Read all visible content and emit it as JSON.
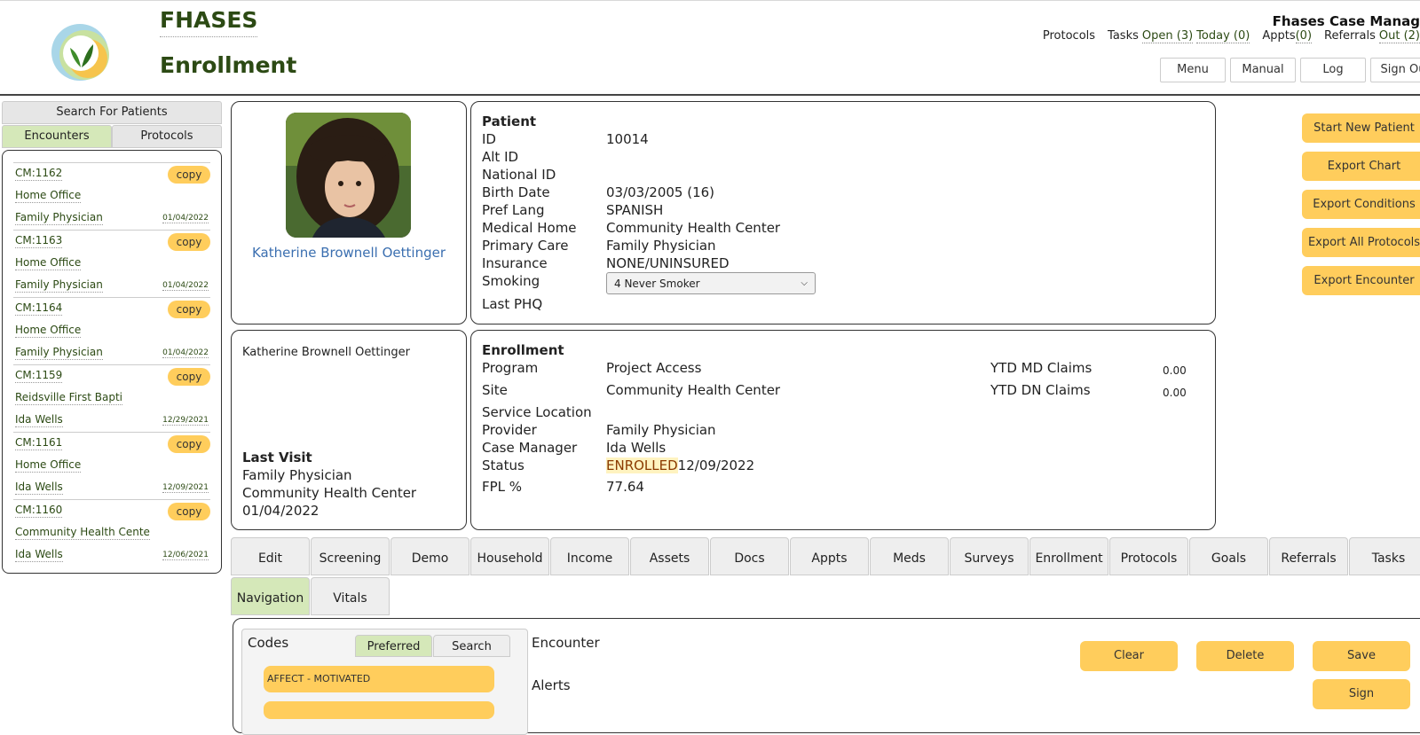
{
  "brand": {
    "title": "FHASES",
    "page_title": "Enrollment",
    "app_name": "Fhases Case Manag"
  },
  "topnav": {
    "protocols": "Protocols",
    "tasks_label": "Tasks",
    "tasks_open": "Open (3)",
    "tasks_today": "Today (0)",
    "appts_label": "Appts",
    "appts_count": "(0)",
    "referrals_label": "Referrals",
    "referrals_out": "Out (2)"
  },
  "header_buttons": {
    "menu": "Menu",
    "manual": "Manual",
    "log": "Log",
    "sign_out": "Sign Ou"
  },
  "sidebar": {
    "search": "Search For Patients",
    "tabs": [
      "Encounters",
      "Protocols"
    ],
    "copy_label": "copy",
    "encounters": [
      {
        "id": "CM:1162",
        "location": "Home Office",
        "provider": "Family Physician",
        "date": "01/04/2022"
      },
      {
        "id": "CM:1163",
        "location": "Home Office",
        "provider": "Family Physician",
        "date": "01/04/2022"
      },
      {
        "id": "CM:1164",
        "location": "Home Office",
        "provider": "Family Physician",
        "date": "01/04/2022"
      },
      {
        "id": "CM:1159",
        "location": "Reidsville First Bapti",
        "provider": "Ida Wells",
        "date": "12/29/2021"
      },
      {
        "id": "CM:1161",
        "location": "Home Office",
        "provider": "Ida Wells",
        "date": "12/09/2021"
      },
      {
        "id": "CM:1160",
        "location": "Community Health Cente",
        "provider": "Ida Wells",
        "date": "12/06/2021"
      }
    ]
  },
  "patient_card": {
    "name": "Katherine Brownell Oettinger",
    "name_small": "Katherine Brownell Oettinger",
    "last_visit_title": "Last Visit",
    "last_visit_provider": "Family Physician",
    "last_visit_site": "Community Health Center",
    "last_visit_date": "01/04/2022"
  },
  "patient": {
    "title": "Patient",
    "labels": {
      "id": "ID",
      "alt_id": "Alt ID",
      "national_id": "National ID",
      "birth_date": "Birth Date",
      "pref_lang": "Pref Lang",
      "medical_home": "Medical Home",
      "primary_care": "Primary Care",
      "insurance": "Insurance",
      "smoking": "Smoking",
      "last_phq": "Last PHQ"
    },
    "values": {
      "id": "10014",
      "birth_date": "03/03/2005 (16)",
      "pref_lang": "SPANISH",
      "medical_home": "Community Health Center",
      "primary_care": "Family Physician",
      "insurance": "NONE/UNINSURED",
      "smoking": "4 Never Smoker"
    }
  },
  "enrollment": {
    "title": "Enrollment",
    "labels": {
      "program": "Program",
      "site": "Site",
      "service_location": "Service Location",
      "provider": "Provider",
      "case_manager": "Case Manager",
      "status": "Status",
      "fpl": "FPL %",
      "ytd_md": "YTD MD Claims",
      "ytd_dn": "YTD DN Claims"
    },
    "values": {
      "program": "Project Access",
      "site": "Community Health Center",
      "provider": "Family Physician",
      "case_manager": "Ida Wells",
      "status": "ENROLLED",
      "status_date": "12/09/2022",
      "fpl": "77.64",
      "ytd_md": "0.00",
      "ytd_dn": "0.00"
    }
  },
  "actions": [
    "Start New Patient",
    "Export Chart",
    "Export Conditions",
    "Export All Protocols",
    "Export Encounter"
  ],
  "tabs": [
    "Edit",
    "Screening",
    "Demo",
    "Household",
    "Income",
    "Assets",
    "Docs",
    "Appts",
    "Meds",
    "Surveys",
    "Enrollment",
    "Protocols",
    "Goals",
    "Referrals",
    "Tasks"
  ],
  "subtabs": [
    "Navigation",
    "Vitals"
  ],
  "codes": {
    "title": "Codes",
    "tabs": [
      "Preferred",
      "Search"
    ],
    "items": [
      "AFFECT - MOTIVATED",
      ""
    ]
  },
  "encounter": {
    "title": "Encounter",
    "alerts": "Alerts",
    "buttons": {
      "clear": "Clear",
      "delete": "Delete",
      "save": "Save",
      "sign": "Sign"
    }
  },
  "colors": {
    "accent": "#ffcd5c",
    "active_tab": "#d5e8b9",
    "brand_green": "#2c4a14",
    "link_blue": "#3b6fb0"
  }
}
